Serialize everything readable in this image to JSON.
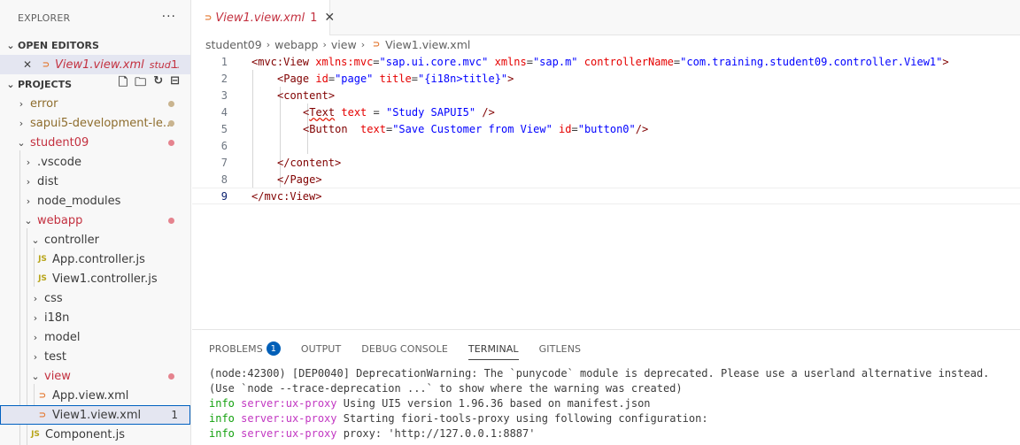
{
  "sidebar": {
    "title": "EXPLORER",
    "more": "···",
    "open_editors": {
      "label": "OPEN EDITORS",
      "item": {
        "name": "View1.view.xml",
        "folder": "stud...",
        "count": "1"
      }
    },
    "projects": {
      "label": "PROJECTS",
      "items": [
        {
          "label": "error",
          "type": "folder"
        },
        {
          "label": "sapui5-development-le...",
          "type": "folder"
        },
        {
          "label": "student09",
          "type": "folder"
        },
        {
          "label": ".vscode",
          "type": "folder"
        },
        {
          "label": "dist",
          "type": "folder"
        },
        {
          "label": "node_modules",
          "type": "folder"
        },
        {
          "label": "webapp",
          "type": "folder"
        },
        {
          "label": "controller",
          "type": "folder"
        },
        {
          "label": "App.controller.js",
          "type": "js"
        },
        {
          "label": "View1.controller.js",
          "type": "js"
        },
        {
          "label": "css",
          "type": "folder"
        },
        {
          "label": "i18n",
          "type": "folder"
        },
        {
          "label": "model",
          "type": "folder"
        },
        {
          "label": "test",
          "type": "folder"
        },
        {
          "label": "view",
          "type": "folder"
        },
        {
          "label": "App.view.xml",
          "type": "xml"
        },
        {
          "label": "View1.view.xml",
          "type": "xml",
          "count": "1"
        },
        {
          "label": "Component.js",
          "type": "js"
        }
      ]
    }
  },
  "editor": {
    "tab": {
      "name": "View1.view.xml",
      "count": "1",
      "close": "✕"
    },
    "breadcrumb": [
      "student09",
      "webapp",
      "view",
      "View1.view.xml"
    ],
    "lines": [
      {
        "n": "1",
        "text": "<mvc:View xmlns:mvc=\"sap.ui.core.mvc\" xmlns=\"sap.m\" controllerName=\"com.training.student09.controller.View1\">"
      },
      {
        "n": "2",
        "text": "<Page id=\"page\" title=\"{i18n>title}\">"
      },
      {
        "n": "3",
        "text": "<content>"
      },
      {
        "n": "4",
        "text": "<Text text = \"Study SAPUI5\" />"
      },
      {
        "n": "5",
        "text": "<Button  text=\"Save Customer from View\" id=\"button0\"/>"
      },
      {
        "n": "6",
        "text": ""
      },
      {
        "n": "7",
        "text": "</content>"
      },
      {
        "n": "8",
        "text": "</Page>"
      },
      {
        "n": "9",
        "text": "</mvc:View>"
      }
    ]
  },
  "panel": {
    "tabs": [
      "PROBLEMS",
      "OUTPUT",
      "DEBUG CONSOLE",
      "TERMINAL",
      "GITLENS"
    ],
    "problems_count": "1",
    "active_tab": "TERMINAL",
    "terminal": [
      {
        "text": "(node:42300) [DEP0040] DeprecationWarning: The `punycode` module is deprecated. Please use a userland alternative instead."
      },
      {
        "text": "(Use `node --trace-deprecation ...` to show where the warning was created)"
      },
      {
        "info": "info",
        "source": "server:ux-proxy",
        "text": " Using UI5 version 1.96.36 based on manifest.json"
      },
      {
        "info": "info",
        "source": "server:ux-proxy",
        "text": " Starting fiori-tools-proxy using following configuration:"
      },
      {
        "info": "info",
        "source": "server:ux-proxy",
        "text": " proxy: 'http://127.0.0.1:8887'"
      }
    ]
  },
  "colors": {
    "error_red": "#c3303f",
    "accent_blue": "#005fb8",
    "info_green": "#13a10e",
    "source_magenta": "#c237c2"
  }
}
